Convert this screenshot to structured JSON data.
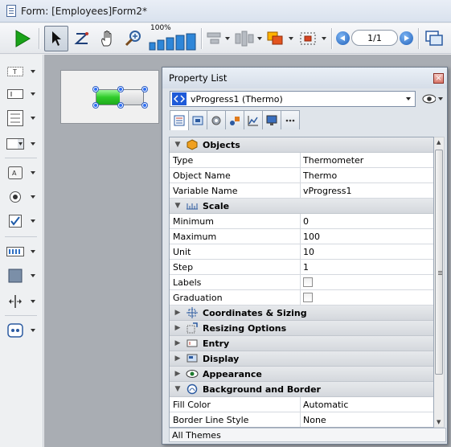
{
  "window": {
    "title": "Form: [Employees]Form2*"
  },
  "toolbar": {
    "zoom_label": "100%",
    "page_indicator": "1/1",
    "icons": [
      "run-icon",
      "arrow-select-icon",
      "z-order-icon",
      "hand-icon",
      "zoom-icon",
      "zoom-bars-icon",
      "align-icon",
      "distribute-icon",
      "group-icon",
      "selection-icon",
      "prev-page-icon",
      "next-page-icon",
      "window-icon"
    ]
  },
  "palette": {
    "tools": [
      "text-tool-icon",
      "field-tool-icon",
      "list-tool-icon",
      "popup-tool-icon",
      "button-tool-icon",
      "radio-tool-icon",
      "checkbox-tool-icon",
      "thermometer-tool-icon",
      "rectangle-tool-icon",
      "splitter-tool-icon",
      "plugin-tool-icon"
    ]
  },
  "canvas": {
    "thermometer_fill": 0.5
  },
  "property_list": {
    "title": "Property List",
    "object_selector": "vProgress1 (Thermo)",
    "close_symbol": "×",
    "categories": {
      "objects": {
        "label": "Objects",
        "expanded": true
      },
      "scale": {
        "label": "Scale",
        "expanded": true
      },
      "coordinates": {
        "label": "Coordinates & Sizing",
        "expanded": false
      },
      "resizing": {
        "label": "Resizing Options",
        "expanded": false
      },
      "entry": {
        "label": "Entry",
        "expanded": false
      },
      "display": {
        "label": "Display",
        "expanded": false
      },
      "appearance": {
        "label": "Appearance",
        "expanded": false
      },
      "background": {
        "label": "Background and Border",
        "expanded": true
      }
    },
    "rows": {
      "type": {
        "key": "Type",
        "value": "Thermometer"
      },
      "object_name": {
        "key": "Object Name",
        "value": "Thermo"
      },
      "variable_name": {
        "key": "Variable Name",
        "value": "vProgress1"
      },
      "minimum": {
        "key": "Minimum",
        "value": "0"
      },
      "maximum": {
        "key": "Maximum",
        "value": "100"
      },
      "unit": {
        "key": "Unit",
        "value": "10"
      },
      "step": {
        "key": "Step",
        "value": "1"
      },
      "labels": {
        "key": "Labels",
        "checked": false
      },
      "graduation": {
        "key": "Graduation",
        "checked": false
      },
      "fill_color": {
        "key": "Fill Color",
        "value": "Automatic"
      },
      "border_line_style": {
        "key": "Border Line Style",
        "value": "None"
      }
    },
    "footer": "All Themes"
  }
}
